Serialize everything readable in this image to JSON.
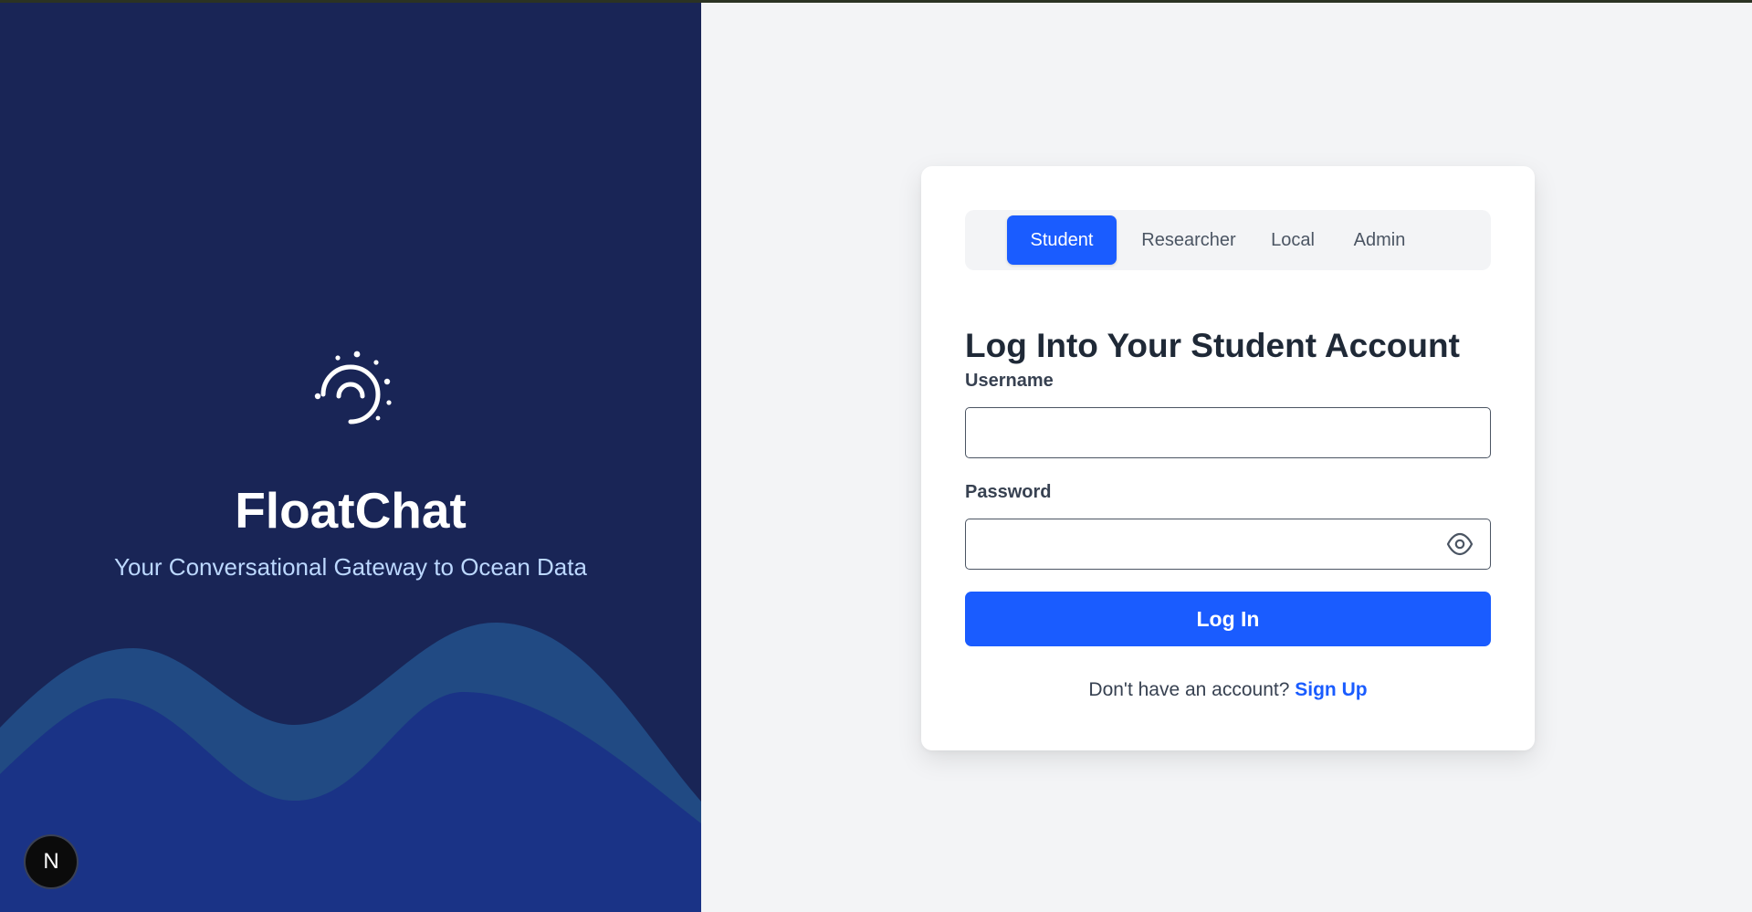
{
  "brand": {
    "name": "FloatChat",
    "tagline": "Your Conversational Gateway to Ocean Data",
    "logo_icon": "gauge-dots-icon"
  },
  "dev_badge": {
    "label": "N",
    "icon": "nextjs-icon"
  },
  "login": {
    "tabs": [
      {
        "label": "Student",
        "active": true
      },
      {
        "label": "Researcher",
        "active": false
      },
      {
        "label": "Local",
        "active": false
      },
      {
        "label": "Admin",
        "active": false
      }
    ],
    "title": "Log Into Your Student Account",
    "username_label": "Username",
    "username_value": "",
    "password_label": "Password",
    "password_value": "",
    "password_toggle_icon": "eye-icon",
    "submit_label": "Log In",
    "signup_prompt": "Don't have an account?",
    "signup_link": "Sign Up"
  },
  "colors": {
    "left_panel": "#192556",
    "wave_back": "#214a83",
    "wave_front": "#1a3386",
    "accent": "#1a5cff",
    "page_bg": "#f3f4f6"
  }
}
